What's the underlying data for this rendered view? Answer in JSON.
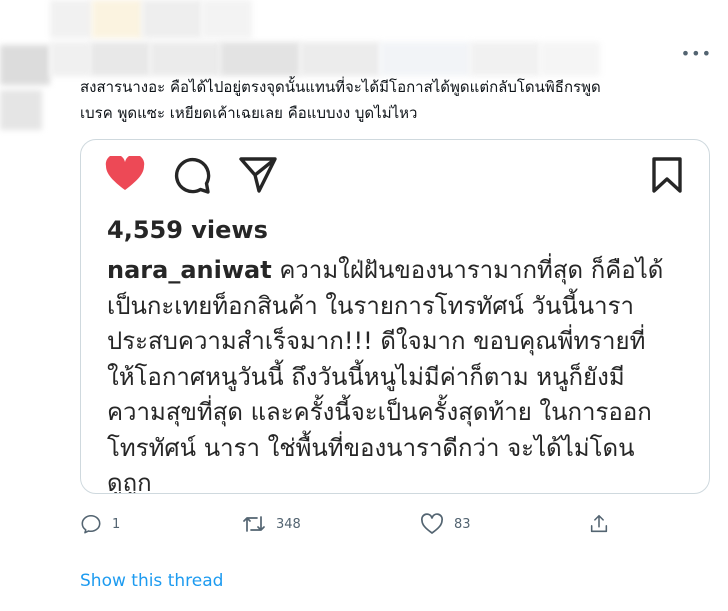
{
  "tweet": {
    "more_icon": "more-horizontal-icon",
    "text_lines": [
      "สงสารนางอะ คือได้ไปอยู่ตรงจุดนั้นแทนที่จะได้มีโอกาสได้พูดแต่กลับโดนพิธีกรพูด",
      "เบรค พูดแซะ เหยียดเค้าเฉยเลย คือแบบงง บูดไม่ไหว"
    ]
  },
  "instagram_post": {
    "icons": [
      "heart-icon",
      "comment-icon",
      "share-icon",
      "bookmark-icon"
    ],
    "views": "4,559 views",
    "username": "nara_aniwat",
    "caption_first": "ความใฝ่ฝันของนารามากที่สุด ก็คือได้",
    "caption_lines": [
      "เป็นกะเทยท็อกสินค้า ในรายการโทรทัศน์ วันนี้นารา",
      "ประสบความสำเร็จมาก!!! ดีใจมาก ขอบคุณพี่ทรายที่",
      "ให้โอกาศหนูวันนี้ ถึงวันนี้หนูไม่มีค่าก็ตาม หนูก็ยังมี",
      "ความสุขที่สุด และครั้งนี้จะเป็นครั้งสุดท้าย ในการออก",
      "โทรทัศน์ นารา ใช่พื้นที่ของนาราดีกว่า จะได้ไม่โดน",
      "ดูถูก"
    ],
    "heart_color": "#ed4956"
  },
  "actions": {
    "reply_count": "1",
    "retweet_count": "348",
    "like_count": "83",
    "icons": [
      "reply-icon",
      "retweet-icon",
      "like-icon",
      "share-icon"
    ]
  },
  "show_thread": "Show this thread",
  "colors": {
    "link": "#1d9bf0",
    "secondary_text": "#536471",
    "border": "#cfd9de"
  }
}
